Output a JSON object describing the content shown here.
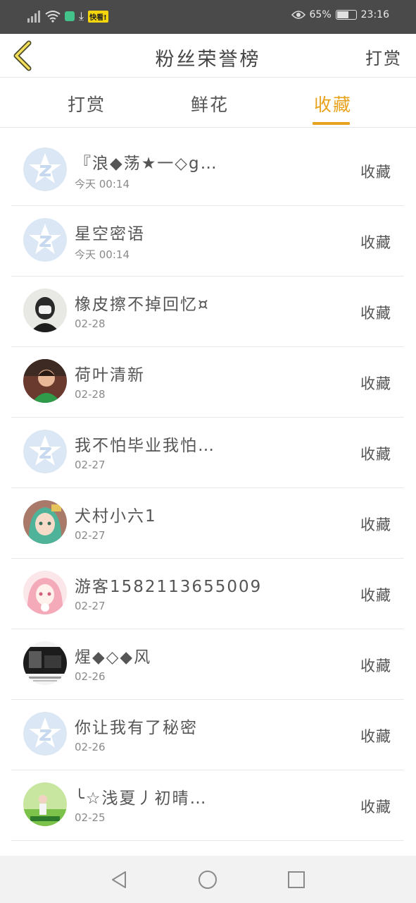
{
  "status_bar": {
    "battery_percent": "65%",
    "battery_level": 0.65,
    "time": "23:16",
    "app_badge": "快看!"
  },
  "header": {
    "title": "粉丝荣誉榜",
    "action_label": "打赏"
  },
  "tabs": [
    {
      "label": "打赏",
      "active": false
    },
    {
      "label": "鲜花",
      "active": false
    },
    {
      "label": "收藏",
      "active": true
    }
  ],
  "colors": {
    "accent": "#e8a31e",
    "status_bar": "#4a4a4a",
    "default_avatar": "#dbe7f4"
  },
  "rows": [
    {
      "name": "『浪◆荡★一◇g…",
      "time": "今天 00:14",
      "action": "收藏",
      "avatar": "default"
    },
    {
      "name": "星空密语",
      "time": "今天 00:14",
      "action": "收藏",
      "avatar": "default"
    },
    {
      "name": "橡皮擦不掉回忆¤",
      "time": "02-28",
      "action": "收藏",
      "avatar": "photo-masked-person"
    },
    {
      "name": "荷叶清新",
      "time": "02-28",
      "action": "收藏",
      "avatar": "photo-boy"
    },
    {
      "name": "我不怕毕业我怕…",
      "time": "02-27",
      "action": "收藏",
      "avatar": "default"
    },
    {
      "name": "犬村小六1",
      "time": "02-27",
      "action": "收藏",
      "avatar": "anime-girl-green"
    },
    {
      "name": "游客1582113655009",
      "time": "02-27",
      "action": "收藏",
      "avatar": "anime-girl-pink"
    },
    {
      "name": "煋◆◇◆风",
      "time": "02-26",
      "action": "收藏",
      "avatar": "photo-dark"
    },
    {
      "name": "你让我有了秘密",
      "time": "02-26",
      "action": "收藏",
      "avatar": "default"
    },
    {
      "name": "╰☆浅夏丿初晴…",
      "time": "02-25",
      "action": "收藏",
      "avatar": "photo-girl-field"
    }
  ],
  "nav": {
    "back": "back-triangle-icon",
    "home": "home-circle-icon",
    "recents": "recents-square-icon"
  }
}
